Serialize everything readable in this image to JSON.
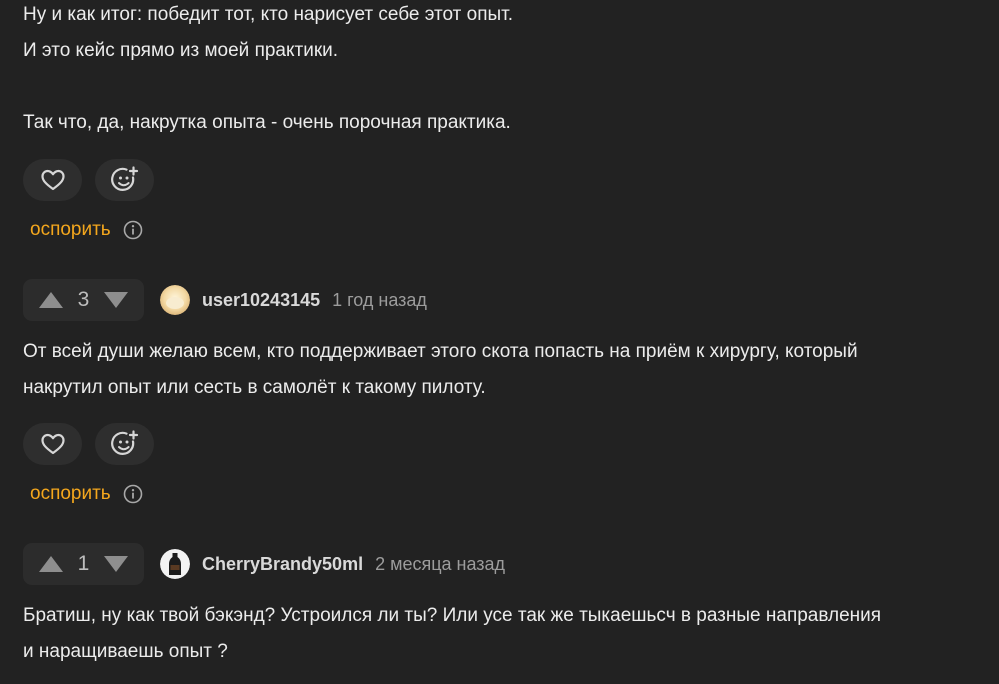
{
  "comment0": {
    "lines": [
      "Ну и как итог: победит тот, кто нарисует себе этот опыт.",
      "И это кейс прямо из моей практики.",
      "",
      "Так что, да, накрутка опыта - очень порочная практика."
    ],
    "like_icon": "heart-icon",
    "emoji_icon": "smile-plus-icon",
    "dispute_label": "оспорить",
    "info_icon": "info-icon"
  },
  "comment1": {
    "votes": "3",
    "username": "user10243145",
    "time": "1 год назад",
    "lines": [
      "От всей души желаю всем, кто поддерживает этого скота попасть на приём к хирургу, который",
      "накрутил опыт или сесть в самолёт к такому пилоту."
    ],
    "dispute_label": "оспорить"
  },
  "comment2": {
    "votes": "1",
    "username": "CherryBrandy50ml",
    "time": "2 месяца назад",
    "lines": [
      "Братиш, ну как твой бэкэнд? Устроился ли ты? Или усе так же тыкаешьсч в разные направления",
      "и наращиваешь опыт ?"
    ]
  },
  "colors": {
    "background": "#222222",
    "text": "#ececec",
    "accent": "#f4a71d",
    "muted": "#9c9c9c",
    "button_bg": "#2e2e2e"
  }
}
